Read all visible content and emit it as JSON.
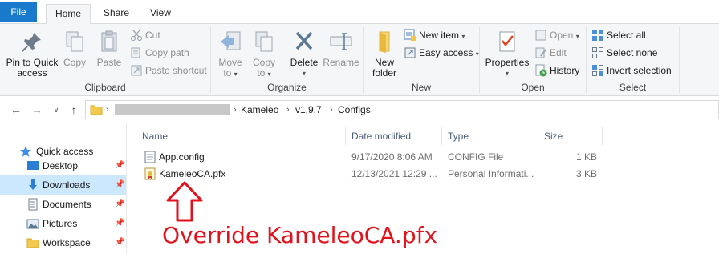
{
  "ribbon_tabs": {
    "file": "File",
    "home": "Home",
    "share": "Share",
    "view": "View"
  },
  "clipboard": {
    "label": "Clipboard",
    "pin": "Pin to Quick\naccess",
    "pin_l1": "Pin to Quick",
    "pin_l2": "access",
    "copy": "Copy",
    "paste": "Paste",
    "cut": "Cut",
    "copy_path": "Copy path",
    "paste_shortcut": "Paste shortcut"
  },
  "organize": {
    "label": "Organize",
    "move_to_l1": "Move",
    "move_to_l2": "to",
    "copy_to_l1": "Copy",
    "copy_to_l2": "to",
    "delete": "Delete",
    "rename": "Rename"
  },
  "new_group": {
    "label": "New",
    "new_folder_l1": "New",
    "new_folder_l2": "folder",
    "new_item": "New item",
    "easy_access": "Easy access"
  },
  "open_group": {
    "label": "Open",
    "properties": "Properties",
    "open": "Open",
    "edit": "Edit",
    "history": "History"
  },
  "select_group": {
    "label": "Select",
    "select_all": "Select all",
    "select_none": "Select none",
    "invert_selection": "Invert selection"
  },
  "breadcrumb": [
    "Kameleo",
    "v1.9.7",
    "Configs"
  ],
  "nav_pane": {
    "quick_access": "Quick access",
    "items": [
      {
        "label": "Desktop",
        "icon": "desktop-icon",
        "selected": false
      },
      {
        "label": "Downloads",
        "icon": "downloads-icon",
        "selected": true
      },
      {
        "label": "Documents",
        "icon": "documents-icon",
        "selected": false
      },
      {
        "label": "Pictures",
        "icon": "pictures-icon",
        "selected": false
      },
      {
        "label": "Workspace",
        "icon": "folder-icon",
        "selected": false
      }
    ]
  },
  "file_list": {
    "columns": [
      "Name",
      "Date modified",
      "Type",
      "Size"
    ],
    "rows": [
      {
        "name": "App.config",
        "date": "9/17/2020 8:06 AM",
        "type": "CONFIG File",
        "size": "1 KB",
        "icon": "config-file-icon"
      },
      {
        "name": "KameleoCA.pfx",
        "date": "12/13/2021 12:29 ...",
        "type": "Personal Informati...",
        "size": "3 KB",
        "icon": "certificate-file-icon"
      }
    ]
  },
  "annotation": {
    "text": "Override KameleoCA.pfx",
    "color": "#e0121b"
  },
  "colors": {
    "file_tab": "#1979ca",
    "selected_nav": "#cce8ff",
    "ribbon_bg": "#f5f6f7"
  }
}
